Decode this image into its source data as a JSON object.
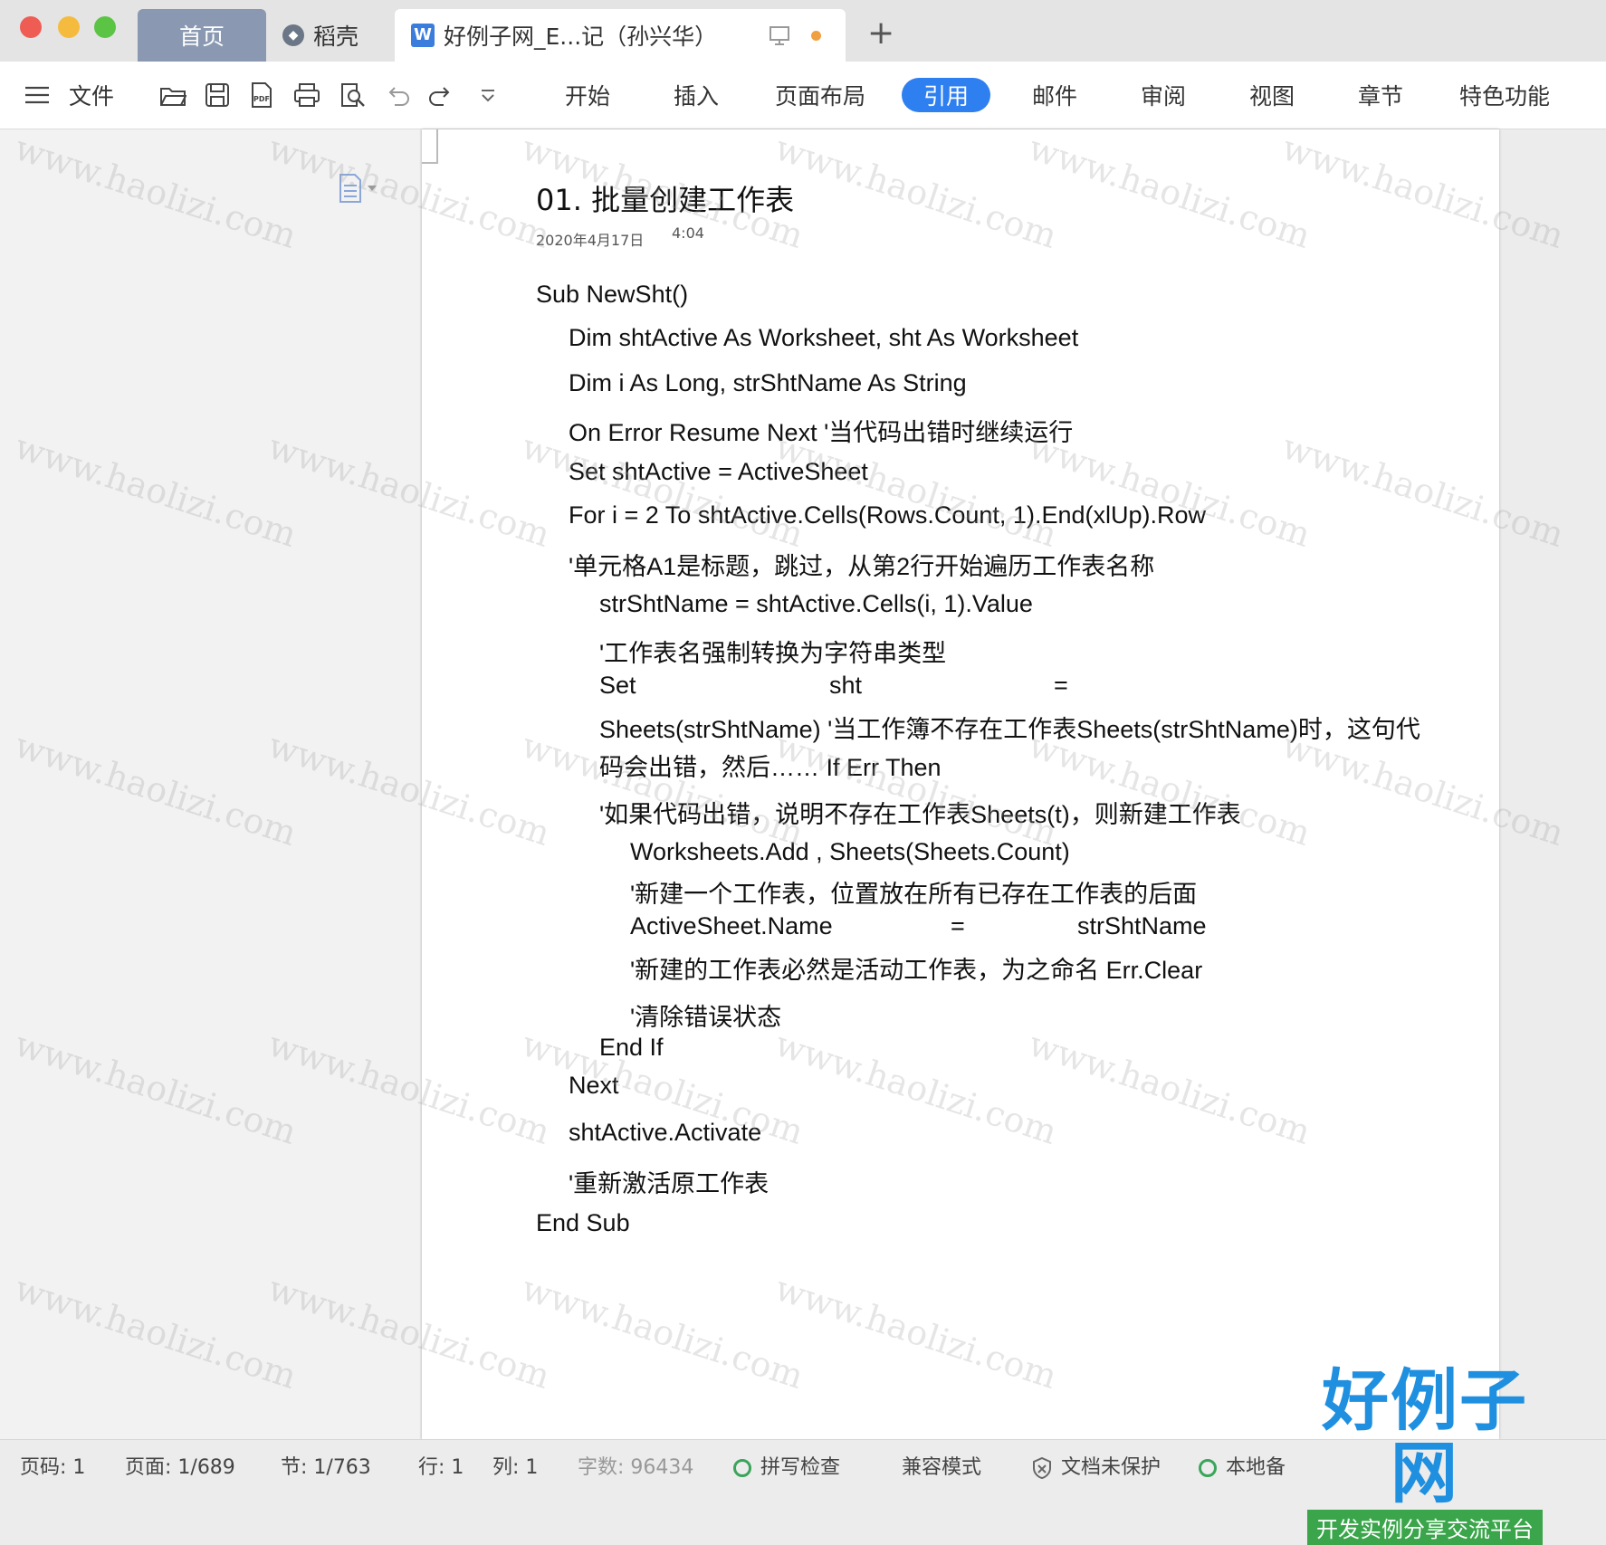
{
  "window": {
    "tabs": [
      {
        "label": "首页"
      },
      {
        "label": "稻壳"
      },
      {
        "label": "好例子网_E...记（孙兴华）"
      }
    ],
    "new_tab": "+"
  },
  "toolbar": {
    "file_label": "文件",
    "menus": [
      "开始",
      "插入",
      "页面布局",
      "引用",
      "邮件",
      "审阅",
      "视图",
      "章节",
      "特色功能"
    ],
    "active_menu": "引用"
  },
  "document": {
    "title": "01.  批量创建工作表",
    "date": "2020年4月17日",
    "time": "4:04",
    "lines": [
      "Sub NewSht()",
      "Dim shtActive As Worksheet, sht As Worksheet",
      "Dim i As Long, strShtName As String",
      "On Error Resume Next '当代码出错时继续运行",
      "Set shtActive = ActiveSheet",
      "For i = 2 To shtActive.Cells(Rows.Count, 1).End(xlUp).Row",
      "'单元格A1是标题，跳过，从第2行开始遍历工作表名称",
      "strShtName = shtActive.Cells(i, 1).Value",
      "'工作表名强制转换为字符串类型",
      "Set",
      "sht",
      "=",
      "Sheets(strShtName) '当工作簿不存在工作表Sheets(strShtName)时，这句代",
      "码会出错，然后…… If Err Then",
      "'如果代码出错，说明不存在工作表Sheets(t)，则新建工作表",
      "Worksheets.Add , Sheets(Sheets.Count)",
      "'新建一个工作表，位置放在所有已存在工作表的后面",
      "ActiveSheet.Name",
      "=",
      "strShtName",
      "'新建的工作表必然是活动工作表，为之命名 Err.Clear",
      "'清除错误状态",
      "End If",
      "Next",
      "shtActive.Activate",
      "'重新激活原工作表",
      "End Sub"
    ]
  },
  "status": {
    "page_code": "页码: 1",
    "pages": "页面: 1/689",
    "section": "节: 1/763",
    "row": "行: 1",
    "col": "列: 1",
    "word_count": "字数: 96434",
    "spell_check": "拼写检查",
    "compat": "兼容模式",
    "protect": "文档未保护",
    "backup": "本地备"
  },
  "watermark": {
    "text": "www.haolizi.com",
    "brand": "好例子网",
    "brand_sub": "开发实例分享交流平台"
  },
  "colors": {
    "accent": "#2e7ff0",
    "home_tab": "#8a99b1",
    "brand_blue": "#1f8fe0",
    "brand_green": "#3aa54a"
  }
}
